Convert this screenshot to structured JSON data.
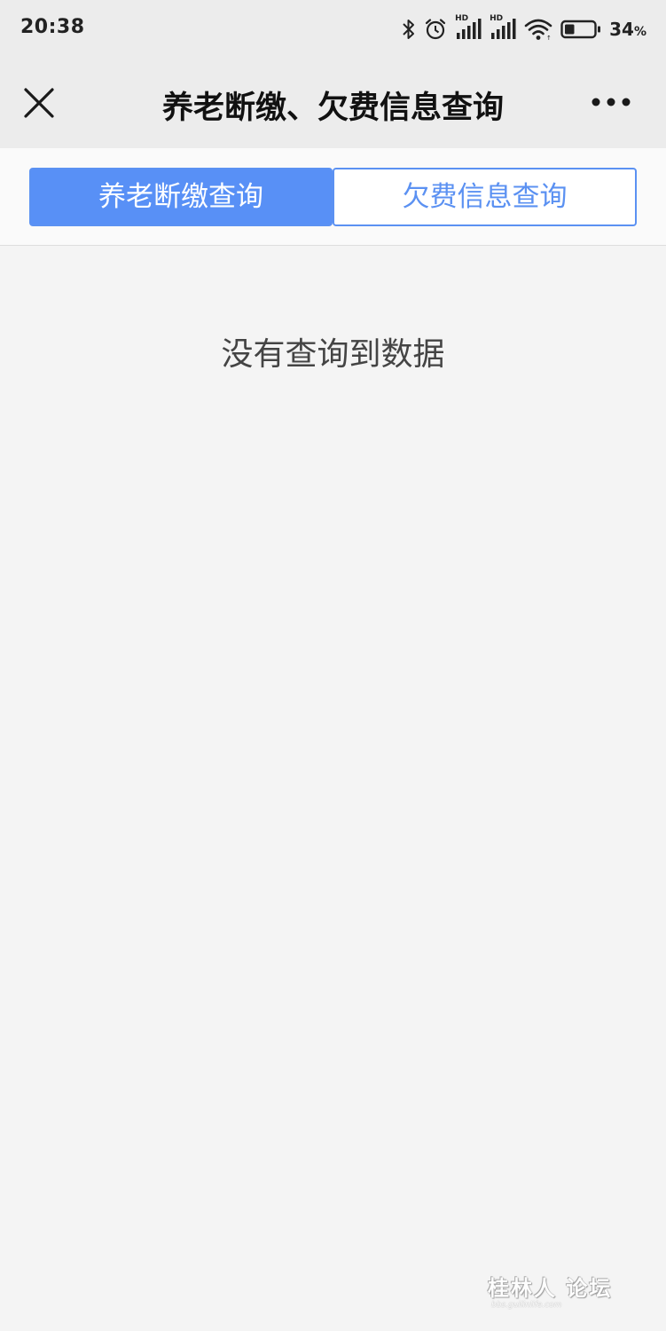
{
  "status_bar": {
    "time": "20:38",
    "battery_percent": "34",
    "battery_unit": "%",
    "network_badges": [
      "HD",
      "HD"
    ],
    "icons": [
      "bluetooth-icon",
      "alarm-icon",
      "signal-icon",
      "signal-icon",
      "wifi-icon",
      "battery-icon"
    ]
  },
  "nav": {
    "title": "养老断缴、欠费信息查询",
    "close_icon": "close-icon",
    "more_icon": "more-icon"
  },
  "tabs": [
    {
      "label": "养老断缴查询",
      "active": true
    },
    {
      "label": "欠费信息查询",
      "active": false
    }
  ],
  "content": {
    "empty_message": "没有查询到数据"
  },
  "watermark": {
    "text": "桂林人 论坛",
    "sub": "bbs.guilinlife.com"
  },
  "colors": {
    "accent": "#5890f6",
    "header_bg": "#ececec",
    "page_bg": "#f4f4f4"
  }
}
